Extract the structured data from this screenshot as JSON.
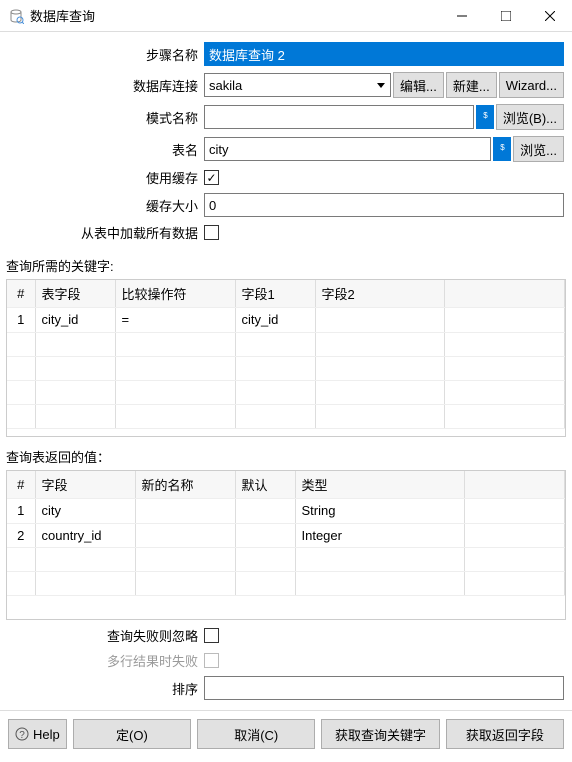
{
  "window": {
    "title": "数据库查询"
  },
  "form": {
    "stepName": {
      "label": "步骤名称",
      "value": "数据库查询 2"
    },
    "connection": {
      "label": "数据库连接",
      "value": "sakila",
      "editBtn": "编辑...",
      "newBtn": "新建...",
      "wizardBtn": "Wizard..."
    },
    "schema": {
      "label": "模式名称",
      "value": "",
      "browseBtn": "浏览(B)..."
    },
    "table": {
      "label": "表名",
      "value": "city",
      "browseBtn": "浏览..."
    },
    "useCache": {
      "label": "使用缓存",
      "checked": true
    },
    "cacheSize": {
      "label": "缓存大小",
      "value": "0"
    },
    "loadAll": {
      "label": "从表中加载所有数据",
      "checked": false
    }
  },
  "keysSection": {
    "title": "查询所需的关键字:",
    "headers": {
      "num": "#",
      "field": "表字段",
      "op": "比较操作符",
      "f1": "字段1",
      "f2": "字段2"
    },
    "rows": [
      {
        "num": "1",
        "field": "city_id",
        "op": "=",
        "f1": "city_id",
        "f2": ""
      }
    ]
  },
  "returnSection": {
    "title": "查询表返回的值：",
    "headers": {
      "num": "#",
      "field": "字段",
      "newname": "新的名称",
      "def": "默认",
      "type": "类型"
    },
    "rows": [
      {
        "num": "1",
        "field": "city",
        "newname": "",
        "def": "",
        "type": "String"
      },
      {
        "num": "2",
        "field": "country_id",
        "newname": "",
        "def": "",
        "type": "Integer"
      }
    ]
  },
  "footer": {
    "ignoreFail": {
      "label": "查询失败则忽略",
      "checked": false
    },
    "multiRowFail": {
      "label": "多行结果时失败",
      "checked": false
    },
    "sort": {
      "label": "排序",
      "value": ""
    }
  },
  "buttons": {
    "help": "Help",
    "ok": "定(O)",
    "cancel": "取消(C)",
    "getKeys": "获取查询关键字",
    "getReturn": "获取返回字段"
  }
}
